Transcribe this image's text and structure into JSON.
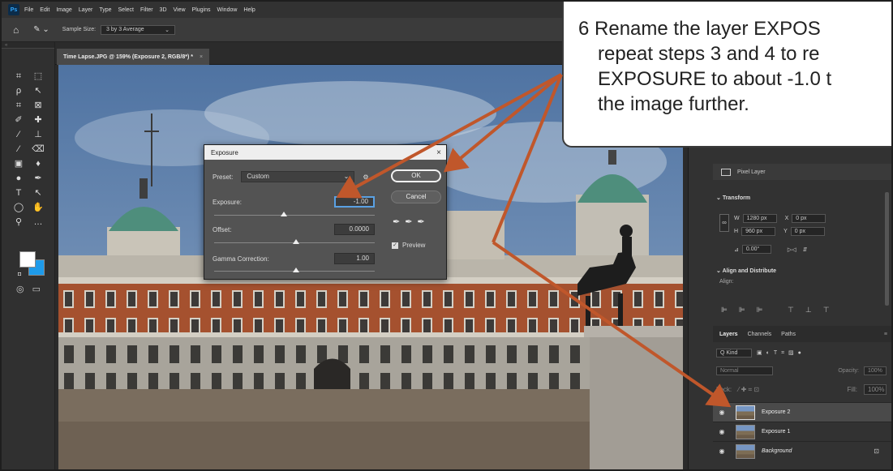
{
  "menubar": {
    "logo": "Ps",
    "items": [
      "File",
      "Edit",
      "Image",
      "Layer",
      "Type",
      "Select",
      "Filter",
      "3D",
      "View",
      "Plugins",
      "Window",
      "Help"
    ]
  },
  "options_bar": {
    "sample_size_label": "Sample Size:",
    "sample_size_value": "3 by 3 Average"
  },
  "document_tab": {
    "title": "Time Lapse.JPG @ 159% (Exposure 2, RGB/8*) *",
    "close": "×"
  },
  "exposure_dialog": {
    "title": "Exposure",
    "preset_label": "Preset:",
    "preset_value": "Custom",
    "exposure_label": "Exposure:",
    "exposure_value": "-1.00",
    "offset_label": "Offset:",
    "offset_value": "0.0000",
    "gamma_label": "Gamma Correction:",
    "gamma_value": "1.00",
    "ok_label": "OK",
    "cancel_label": "Cancel",
    "preview_label": "Preview",
    "preview_checked": true
  },
  "properties": {
    "pixel_layer_label": "Pixel Layer",
    "transform_label": "Transform",
    "w_label": "W",
    "w_value": "1280 px",
    "x_label": "X",
    "x_value": "0 px",
    "h_label": "H",
    "h_value": "960 px",
    "y_label": "Y",
    "y_value": "0 px",
    "angle_value": "0.00°",
    "align_label": "Align and Distribute",
    "align_sub": "Align:"
  },
  "layers_panel": {
    "tabs": [
      "Layers",
      "Channels",
      "Paths"
    ],
    "filter_kind": "Q Kind",
    "blend_mode": "Normal",
    "opacity_label": "Opacity:",
    "opacity_value": "100%",
    "lock_label": "Lock:",
    "fill_label": "Fill:",
    "fill_value": "100%",
    "layers": [
      {
        "name": "Exposure 2",
        "selected": true
      },
      {
        "name": "Exposure 1",
        "selected": false
      },
      {
        "name": "Background",
        "selected": false,
        "locked": true
      }
    ]
  },
  "callout": {
    "line1": "6  Rename the layer EXPOS",
    "line2": "repeat steps 3 and 4 to re",
    "line3": "EXPOSURE to about -1.0 t",
    "line4": "the image further."
  },
  "colors": {
    "accent_arrow": "#c0572b",
    "foreground_swatch": "#ffffff",
    "background_swatch": "#1e9bea"
  }
}
